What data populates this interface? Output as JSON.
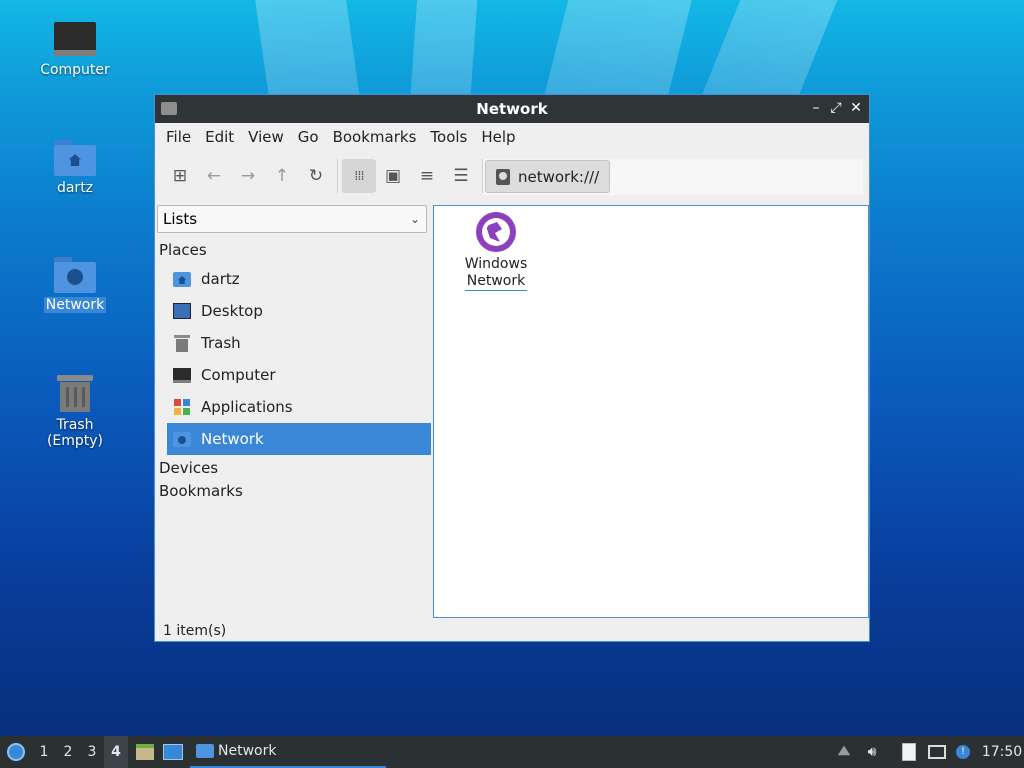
{
  "desktop": {
    "icons": [
      {
        "label": "Computer"
      },
      {
        "label": "dartz"
      },
      {
        "label": "Network"
      },
      {
        "label": "Trash (Empty)"
      }
    ]
  },
  "window": {
    "title": "Network",
    "menu": [
      "File",
      "Edit",
      "View",
      "Go",
      "Bookmarks",
      "Tools",
      "Help"
    ],
    "path": "network:///",
    "side_panel": {
      "selector": "Lists",
      "places_heading": "Places",
      "places": [
        "dartz",
        "Desktop",
        "Trash",
        "Computer",
        "Applications",
        "Network"
      ],
      "selected_place": "Network",
      "devices_heading": "Devices",
      "bookmarks_heading": "Bookmarks"
    },
    "items": [
      {
        "name_line1": "Windows",
        "name_line2": "Network",
        "icon": "network-globe-icon"
      }
    ],
    "status": "1 item(s)"
  },
  "taskbar": {
    "workspaces": [
      "1",
      "2",
      "3",
      "4"
    ],
    "active_workspace": "4",
    "task_label": "Network",
    "clock": "17:50"
  },
  "colors": {
    "accent": "#3a87d8",
    "titlebar": "#2f3437",
    "globe": "#8e3fc0"
  }
}
